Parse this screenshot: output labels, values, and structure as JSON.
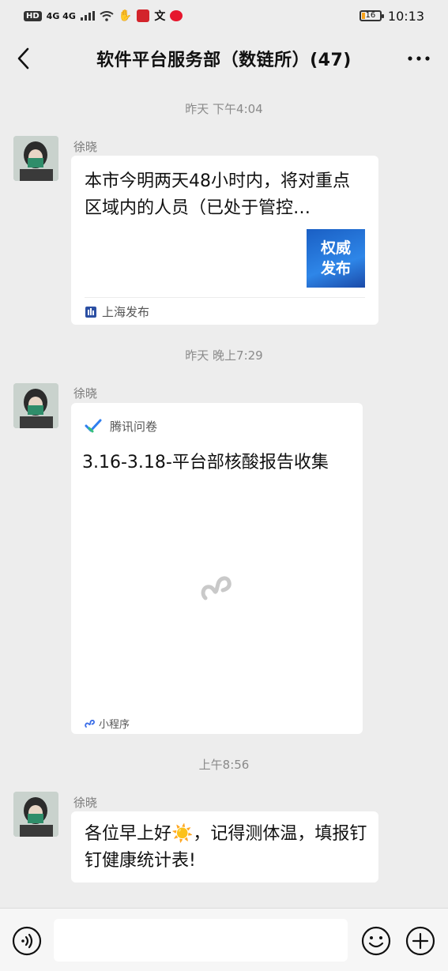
{
  "status": {
    "left_indicators": "4G 4G",
    "time": "10:13",
    "battery": "16"
  },
  "header": {
    "title": "软件平台服务部（数链所）(47)"
  },
  "messages": [
    {
      "timestamp": "昨天 下午4:04",
      "sender": "徐晓",
      "news_text": "本市今明两天48小时内，将对重点区域内的人员（已处于管控…",
      "thumb_line1": "权威",
      "thumb_line2": "发布",
      "source": "上海发布"
    },
    {
      "timestamp": "昨天 晚上7:29",
      "sender": "徐晓",
      "app_name": "腾讯问卷",
      "mini_title": "3.16-3.18-平台部核酸报告收集",
      "mini_footer": "小程序"
    },
    {
      "timestamp": "上午8:56",
      "sender": "徐晓",
      "text": "各位早上好☀️，记得测体温，填报钉钉健康统计表!"
    }
  ],
  "input": {
    "placeholder": ""
  },
  "colors": {
    "background": "#ededed",
    "bubble": "#ffffff",
    "timestamp": "#8a8a8a",
    "thumb_blue": "#1a5fc4"
  }
}
